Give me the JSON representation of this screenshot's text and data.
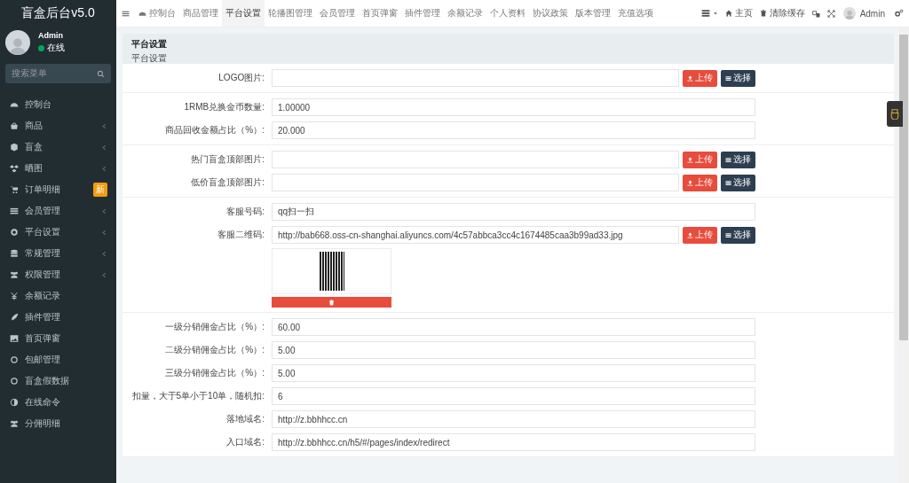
{
  "sidebar": {
    "title": "盲盒后台v5.0",
    "user": {
      "name": "Admin",
      "status": "在线",
      "online": true
    },
    "search": {
      "placeholder": "搜索菜单"
    },
    "items": [
      {
        "label": "控制台",
        "kind": "link"
      },
      {
        "label": "商品",
        "kind": "group"
      },
      {
        "label": "盲盒",
        "kind": "group"
      },
      {
        "label": "晒图",
        "kind": "group"
      },
      {
        "label": "订单明细",
        "kind": "link",
        "badge": "新"
      },
      {
        "label": "会员管理",
        "kind": "group"
      },
      {
        "label": "平台设置",
        "kind": "group"
      },
      {
        "label": "常规管理",
        "kind": "group"
      },
      {
        "label": "权限管理",
        "kind": "group"
      },
      {
        "label": "余额记录",
        "kind": "link"
      },
      {
        "label": "插件管理",
        "kind": "link"
      },
      {
        "label": "首页弹窗",
        "kind": "link"
      },
      {
        "label": "包邮管理",
        "kind": "link"
      },
      {
        "label": "盲盒假数据",
        "kind": "link"
      },
      {
        "label": "在线命令",
        "kind": "link"
      },
      {
        "label": "分佣明细",
        "kind": "link"
      }
    ]
  },
  "topbar": {
    "tabs": [
      {
        "label": "控制台",
        "selected": false
      },
      {
        "label": "商品管理",
        "selected": false
      },
      {
        "label": "平台设置",
        "selected": true
      },
      {
        "label": "轮播图管理",
        "selected": false
      },
      {
        "label": "会员管理",
        "selected": false
      },
      {
        "label": "首页弹窗",
        "selected": false
      },
      {
        "label": "插件管理",
        "selected": false
      },
      {
        "label": "余额记录",
        "selected": false
      },
      {
        "label": "个人资料",
        "selected": false
      },
      {
        "label": "协议政策",
        "selected": false
      },
      {
        "label": "版本管理",
        "selected": false
      },
      {
        "label": "充值选项",
        "selected": false
      }
    ],
    "links": [
      {
        "label": "主页"
      },
      {
        "label": "清除缓存"
      }
    ],
    "user": {
      "name": "Admin"
    }
  },
  "panel": {
    "title": "平台设置",
    "subtitle": "平台设置",
    "groups": [
      {
        "rows": [
          {
            "label": "LOGO图片:",
            "value": "",
            "kind": "upload",
            "buttons": [
              "上传",
              "选择"
            ]
          }
        ]
      },
      {
        "rows": [
          {
            "label": "1RMB兑换金币数量:",
            "value": "1.00000",
            "kind": "text"
          },
          {
            "label": "商品回收金额占比（%）:",
            "value": "20.000",
            "kind": "text"
          }
        ]
      },
      {
        "rows": [
          {
            "label": "热门盲盒顶部图片:",
            "value": "",
            "kind": "upload",
            "buttons": [
              "上传",
              "选择"
            ]
          },
          {
            "label": "低价盲盒顶部图片:",
            "value": "",
            "kind": "upload",
            "buttons": [
              "上传",
              "选择"
            ]
          }
        ]
      },
      {
        "rows": [
          {
            "label": "客服号码:",
            "value": "qq扫一扫",
            "kind": "text"
          },
          {
            "label": "客服二维码:",
            "value": "http://bab668.oss-cn-shanghai.aliyuncs.com/4c57abbca3cc4c1674485caa3b99ad33.jpg",
            "kind": "upload",
            "buttons": [
              "上传",
              "选择"
            ],
            "preview": true
          }
        ]
      },
      {
        "rows": [
          {
            "label": "一级分销佣金占比（%）:",
            "value": "60.00",
            "kind": "text"
          },
          {
            "label": "二级分销佣金占比（%）:",
            "value": "5.00",
            "kind": "text"
          },
          {
            "label": "三级分销佣金占比（%）:",
            "value": "5.00",
            "kind": "text"
          },
          {
            "label": "扣量，大于5单小于10单，随机扣:",
            "value": "6",
            "kind": "text"
          },
          {
            "label": "落地域名:",
            "value": "http://z.bbhhcc.cn",
            "kind": "text"
          },
          {
            "label": "入口域名:",
            "value": "http://z.bbhhcc.cn/h5/#/pages/index/redirect",
            "kind": "text"
          }
        ]
      }
    ]
  }
}
